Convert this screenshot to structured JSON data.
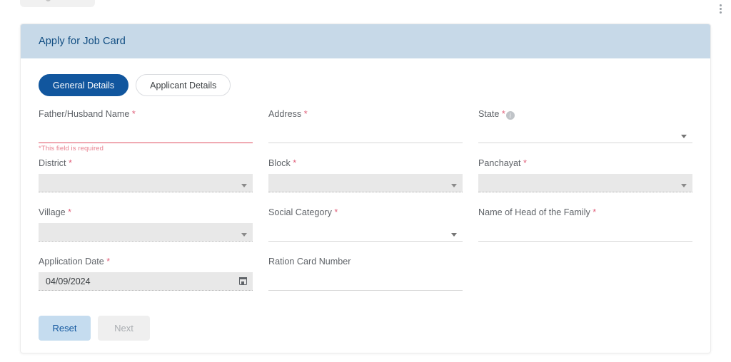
{
  "window": {
    "kebab_menu_icon": "kebab-menu-icon"
  },
  "card": {
    "header_title": "Apply for Job Card"
  },
  "tabs": [
    {
      "label": "General Details",
      "active": true
    },
    {
      "label": "Applicant Details",
      "active": false
    }
  ],
  "fields": {
    "father_husband_name": {
      "label": "Father/Husband Name",
      "required_mark": "*",
      "value": "",
      "error": "*This field is required"
    },
    "address": {
      "label": "Address",
      "required_mark": "*",
      "value": ""
    },
    "state": {
      "label": "State",
      "required_mark": "*",
      "info_icon": "info-icon",
      "info_glyph": "i",
      "value": ""
    },
    "district": {
      "label": "District",
      "required_mark": "*",
      "value": ""
    },
    "block": {
      "label": "Block",
      "required_mark": "*",
      "value": ""
    },
    "panchayat": {
      "label": "Panchayat",
      "required_mark": "*",
      "value": ""
    },
    "village": {
      "label": "Village",
      "required_mark": "*",
      "value": ""
    },
    "social_category": {
      "label": "Social Category",
      "required_mark": "*",
      "value": ""
    },
    "head_of_family": {
      "label": "Name of Head of the Family",
      "required_mark": "*",
      "value": ""
    },
    "application_date": {
      "label": "Application Date",
      "required_mark": "*",
      "value": "04/09/2024",
      "calendar_icon": "calendar-icon"
    },
    "ration_card_number": {
      "label": "Ration Card Number",
      "required_mark": "",
      "value": ""
    }
  },
  "buttons": {
    "reset": "Reset",
    "next": "Next"
  },
  "colors": {
    "header_bg": "#c7d9e8",
    "header_text": "#0f4c81",
    "tab_active_bg": "#11569e",
    "required_star": "#e0607a",
    "error_text": "#e8808f",
    "error_underline": "#e04c5f",
    "reset_bg": "#c5dcef",
    "reset_text": "#11569e",
    "next_bg": "#efefef",
    "next_text": "#a9adb1",
    "disabled_field_bg": "#e8e8e8"
  }
}
